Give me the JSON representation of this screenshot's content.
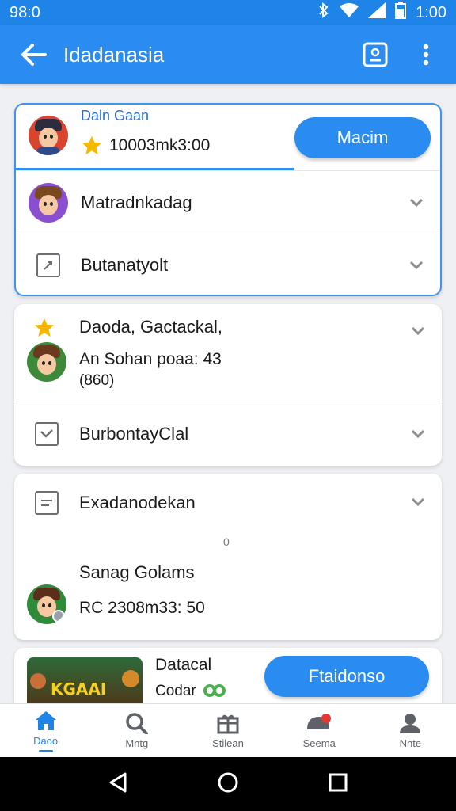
{
  "status_bar": {
    "time": "98:0",
    "clock": "1:00"
  },
  "app_bar": {
    "title": "Idadanasia"
  },
  "card1": {
    "header_name": "Daln Gaan",
    "header_value": "10003mk3:00",
    "header_button": "Macim",
    "progress_fraction": 0.65,
    "row1_label": "Matradnkadag",
    "row2_label": "Butanatyolt"
  },
  "card2": {
    "title": "Daoda, Gactackal,",
    "line1": "An Sohan poaa: 43",
    "line2": "(860)",
    "row2_label": "BurbontayClal"
  },
  "card3": {
    "row1_label": "Exadanodekan",
    "dot": "0",
    "name": "Sanag Golams",
    "value": "RC 2308m33: 50"
  },
  "card4": {
    "thumb_text": "KGAAI",
    "title": "Datacal",
    "subtitle": "Codar",
    "button": "Ftaidonso"
  },
  "bottom_nav": [
    {
      "label": "Daoo"
    },
    {
      "label": "Mntg"
    },
    {
      "label": "Stilean"
    },
    {
      "label": "Seema"
    },
    {
      "label": "Nnte"
    }
  ],
  "colors": {
    "primary": "#2a8cf0",
    "status": "#1e84e8",
    "star": "#f5b800",
    "badge_green": "#4caf50"
  }
}
